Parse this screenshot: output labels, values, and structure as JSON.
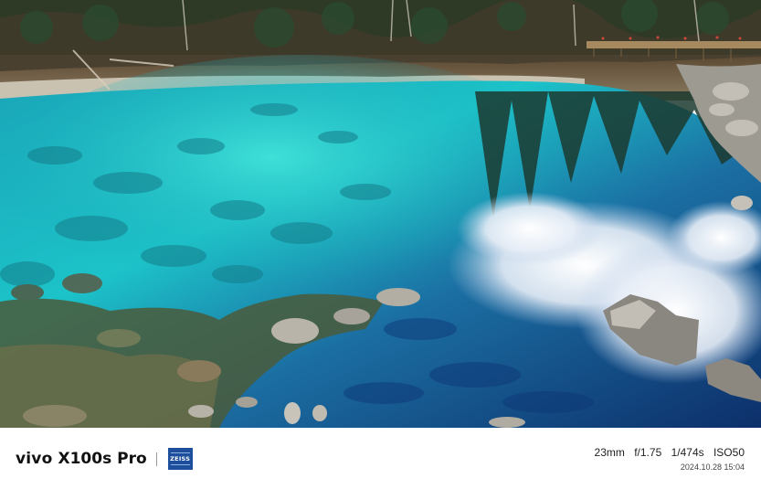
{
  "watermark": {
    "brand": "vivo",
    "model": "X100s Pro",
    "lens_brand": "ZEISS",
    "focal_length": "23mm",
    "aperture": "f/1.75",
    "shutter": "1/474s",
    "iso": "ISO50",
    "timestamp": "2024.10.28 15:04",
    "colors": {
      "lens_logo_bg": "#1d4f9c",
      "text": "#111111"
    }
  }
}
